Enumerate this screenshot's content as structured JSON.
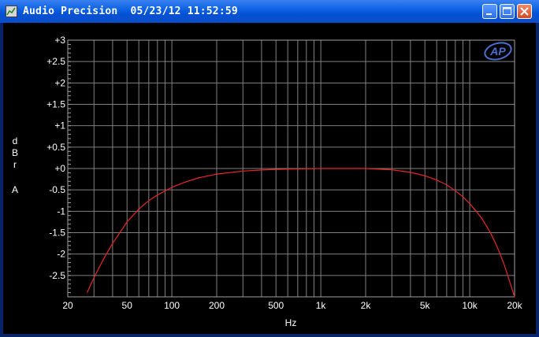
{
  "window": {
    "title": "Audio Precision  05/23/12 11:52:59",
    "logo_text": "AP",
    "controls": [
      "minimize",
      "maximize",
      "close"
    ]
  },
  "colors": {
    "background": "#000000",
    "grid": "#808080",
    "trace": "#e8262a",
    "text": "#ffffff",
    "logo": "#4a6fd0"
  },
  "chart_data": {
    "type": "line",
    "xlabel": "Hz",
    "ylabel": [
      "d",
      "B",
      "r",
      "",
      "A"
    ],
    "x_scale": "log",
    "xlim": [
      20,
      20000
    ],
    "ylim": [
      -3,
      3
    ],
    "grid": true,
    "x_ticks": [
      {
        "value": 20,
        "label": "20"
      },
      {
        "value": 50,
        "label": "50"
      },
      {
        "value": 100,
        "label": "100"
      },
      {
        "value": 200,
        "label": "200"
      },
      {
        "value": 500,
        "label": "500"
      },
      {
        "value": 1000,
        "label": "1k"
      },
      {
        "value": 2000,
        "label": "2k"
      },
      {
        "value": 5000,
        "label": "5k"
      },
      {
        "value": 10000,
        "label": "10k"
      },
      {
        "value": 20000,
        "label": "20k"
      }
    ],
    "y_ticks": [
      {
        "value": 3,
        "label": "+3"
      },
      {
        "value": 2.5,
        "label": "+2.5"
      },
      {
        "value": 2,
        "label": "+2"
      },
      {
        "value": 1.5,
        "label": "+1.5"
      },
      {
        "value": 1,
        "label": "+1"
      },
      {
        "value": 0.5,
        "label": "+0.5"
      },
      {
        "value": 0,
        "label": "+0"
      },
      {
        "value": -0.5,
        "label": "-0.5"
      },
      {
        "value": -1,
        "label": "-1"
      },
      {
        "value": -1.5,
        "label": "-1.5"
      },
      {
        "value": -2,
        "label": "-2"
      },
      {
        "value": -2.5,
        "label": "-2.5"
      }
    ],
    "series": [
      {
        "x": [
          27,
          30,
          35,
          40,
          50,
          60,
          70,
          80,
          100,
          120,
          150,
          200,
          300,
          400,
          500,
          700,
          1000,
          1500,
          2000,
          3000,
          4000,
          5000,
          6000,
          7000,
          8000,
          9000,
          10000,
          11000,
          12000,
          13000,
          14000,
          15000,
          16000,
          17000,
          18000,
          19000,
          20000
        ],
        "y": [
          -2.9,
          -2.55,
          -2.1,
          -1.75,
          -1.25,
          -0.95,
          -0.75,
          -0.62,
          -0.44,
          -0.33,
          -0.22,
          -0.13,
          -0.06,
          -0.035,
          -0.02,
          -0.01,
          0.0,
          0.0,
          0.0,
          -0.03,
          -0.09,
          -0.17,
          -0.27,
          -0.38,
          -0.52,
          -0.66,
          -0.82,
          -0.99,
          -1.16,
          -1.35,
          -1.55,
          -1.77,
          -2.0,
          -2.24,
          -2.5,
          -2.76,
          -3.0
        ]
      }
    ]
  }
}
